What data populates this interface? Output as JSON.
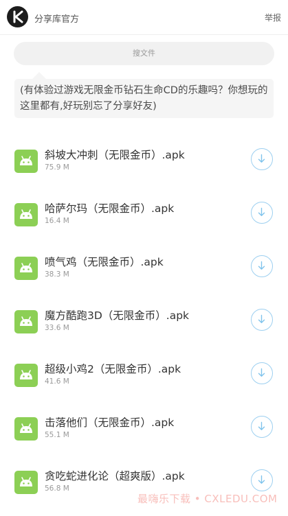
{
  "header": {
    "brand": "分享库官方",
    "report": "举报",
    "logo_icon": "k-logo-icon"
  },
  "search": {
    "label": "搜文件"
  },
  "description": "(有体验过游戏无限金币钻石生命CD的乐趣吗？你想玩的这里都有,好玩别忘了分享好友)",
  "files": [
    {
      "name": "斜坡大冲刺（无限金币）.apk",
      "size": "75.9 M"
    },
    {
      "name": "哈萨尔玛（无限金币）.apk",
      "size": "16.4 M"
    },
    {
      "name": "喷气鸡（无限金币）.apk",
      "size": "38.3 M"
    },
    {
      "name": "魔方酷跑3D（无限金币）.apk",
      "size": "33.6 M"
    },
    {
      "name": "超级小鸡2（无限金币）.apk",
      "size": "41.6 M"
    },
    {
      "name": "击落他们（无限金币）.apk",
      "size": "55.1 M"
    },
    {
      "name": "贪吃蛇进化论（超爽版）.apk",
      "size": "56.8 M"
    }
  ],
  "watermark": "最嗨乐下载 • CXLEDU.COM",
  "colors": {
    "apk_icon": "#8ccf55",
    "download_accent": "#7fc3ec"
  },
  "icons": {
    "file": "android-icon",
    "download": "download-icon"
  }
}
